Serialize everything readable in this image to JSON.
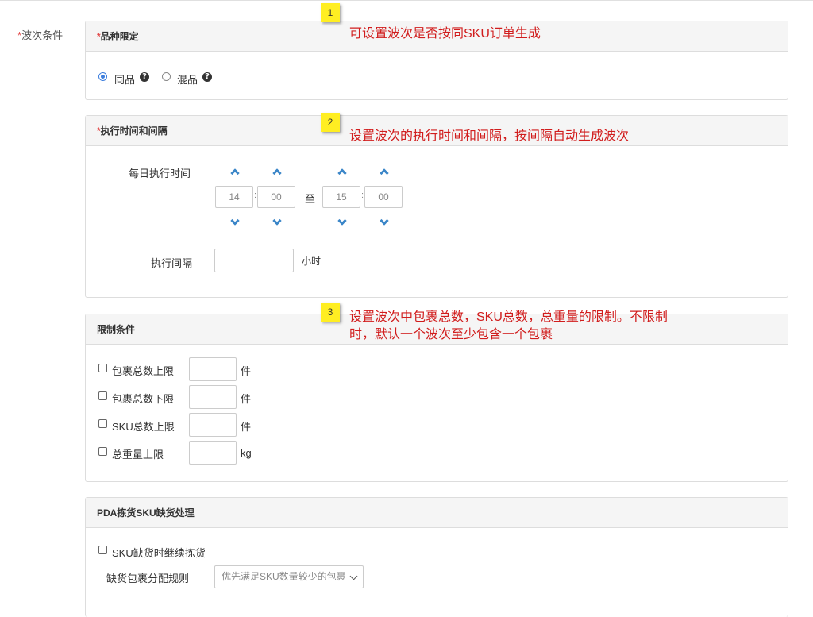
{
  "field_label": {
    "required_mark": "*",
    "text": "波次条件"
  },
  "variety": {
    "required_mark": "*",
    "title": "品种限定",
    "options": [
      {
        "label": "同品",
        "checked": true
      },
      {
        "label": "混品",
        "checked": false
      }
    ],
    "help_glyph": "?"
  },
  "schedule": {
    "required_mark": "*",
    "title": "执行时间和间隔",
    "daily_time_label": "每日执行时间",
    "start_hour": "14",
    "start_minute": "00",
    "separator": ":",
    "to_label": "至",
    "end_hour": "15",
    "end_minute": "00",
    "interval_label": "执行间隔",
    "interval_value": "",
    "interval_unit": "小时"
  },
  "limits": {
    "title": "限制条件",
    "rows": [
      {
        "label": "包裹总数上限",
        "value": "",
        "unit": "件"
      },
      {
        "label": "包裹总数下限",
        "value": "",
        "unit": "件"
      },
      {
        "label": "SKU总数上限",
        "value": "",
        "unit": "件"
      },
      {
        "label": "总重量上限",
        "value": "",
        "unit": "kg"
      }
    ]
  },
  "pda": {
    "title": "PDA拣货SKU缺货处理",
    "continue_label": "SKU缺货时继续拣货",
    "rule_label": "缺货包裹分配规则",
    "rule_selected": "优先满足SKU数量较少的包裹"
  },
  "annotations": [
    {
      "number": "1",
      "text": "可设置波次是否按同SKU订单生成"
    },
    {
      "number": "2",
      "text": "设置波次的执行时间和间隔，按间隔自动生成波次"
    },
    {
      "number": "3",
      "text": "设置波次中包裹总数，SKU总数，总重量的限制。不限制时，默认一个波次至少包含一个包裹"
    }
  ],
  "colors": {
    "accent": "#3b7ddd",
    "annotation_text": "#d11d1d",
    "annotation_badge": "#ffee22",
    "required": "#e34a4a"
  }
}
